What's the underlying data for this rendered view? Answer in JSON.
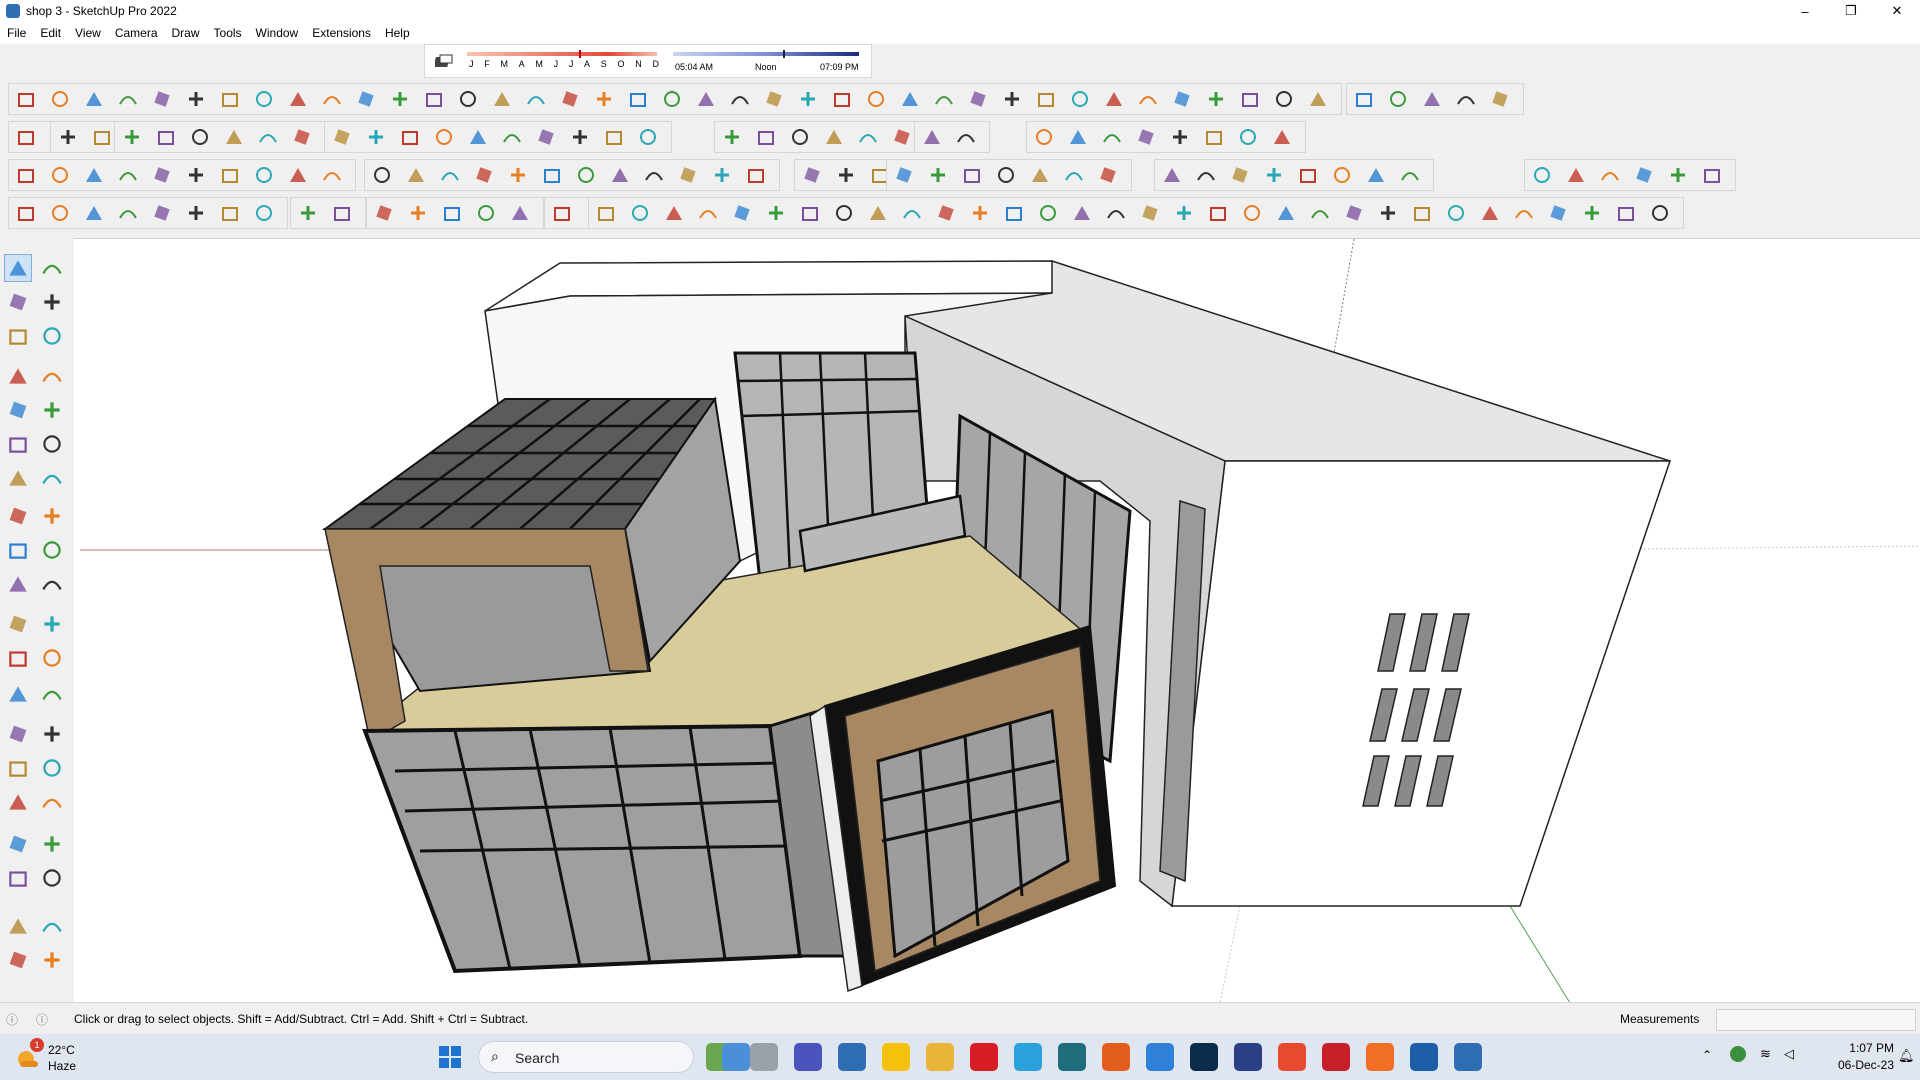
{
  "window": {
    "title": "shop 3 - SketchUp Pro 2022",
    "controls": [
      "–",
      "❐",
      "✕"
    ]
  },
  "menu": [
    "File",
    "Edit",
    "View",
    "Camera",
    "Draw",
    "Tools",
    "Window",
    "Extensions",
    "Help"
  ],
  "shadow_bar": {
    "months": [
      "J",
      "F",
      "M",
      "A",
      "M",
      "J",
      "J",
      "A",
      "S",
      "O",
      "N",
      "D"
    ],
    "time_start": "05:04 AM",
    "time_mid": "Noon",
    "time_end": "07:09 PM"
  },
  "status": {
    "hint": "Click or drag to select objects. Shift = Add/Subtract. Ctrl = Add. Shift + Ctrl = Subtract.",
    "measurements_label": "Measurements",
    "measurements_value": ""
  },
  "taskbar": {
    "weather_temp": "22°C",
    "weather_cond": "Haze",
    "weather_badge": "1",
    "search_placeholder": "Search",
    "time": "1:07 PM",
    "date": "06-Dec-23"
  },
  "colors": {
    "accent": "#2f6db5",
    "glass": "#8f8f8f",
    "wood_frame": "#a88862",
    "deck": "#d9cc9b"
  }
}
